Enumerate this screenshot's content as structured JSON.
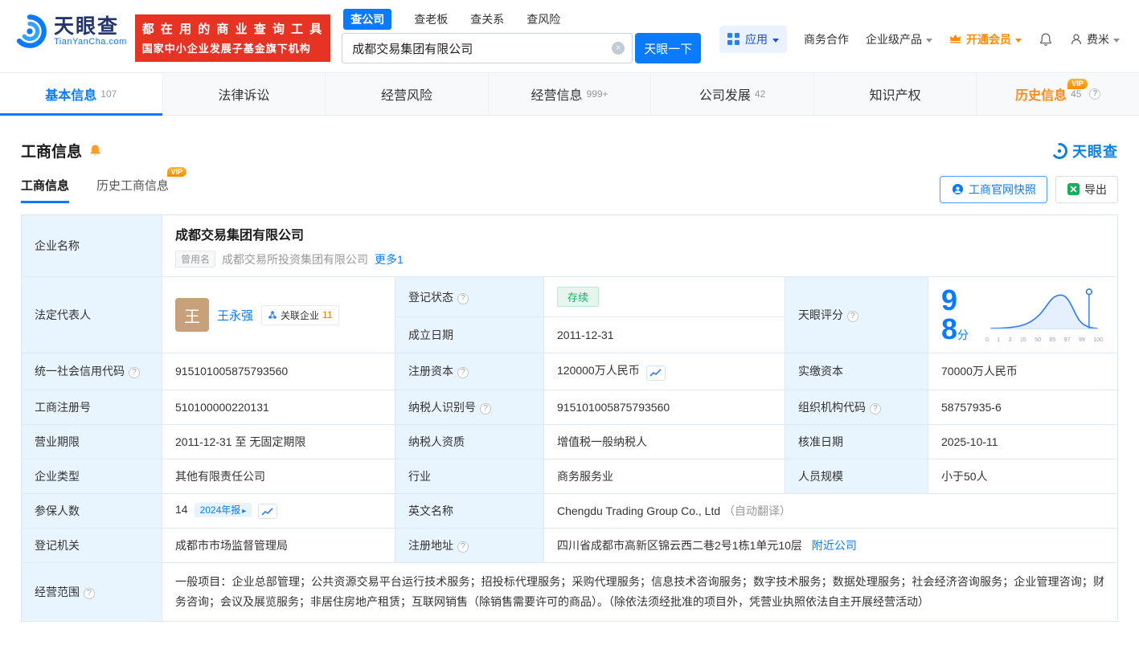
{
  "colors": {
    "brand_blue": "#0a7bff",
    "slogan_red": "#e73324",
    "vip_orange": "#ff8a00",
    "status_green": "#12b268",
    "label_cell_bg": "#e9f5fe"
  },
  "header": {
    "brand": {
      "name": "天眼查",
      "domain": "TianYanCha.com"
    },
    "slogan": [
      "都 在 用 的 商 业 查 询 工 具",
      "国家中小企业发展子基金旗下机构"
    ],
    "search_tabs": [
      "查公司",
      "查老板",
      "查关系",
      "查风险"
    ],
    "search": {
      "value": "成都交易集团有限公司",
      "button": "天眼一下"
    },
    "nav": {
      "apps": "应用",
      "cooperation": "商务合作",
      "enterprise": "企业级产品",
      "vip": "开通会员",
      "user": "费米"
    }
  },
  "vip_badge": "VIP",
  "tabs": [
    {
      "label": "基本信息",
      "count": "107"
    },
    {
      "label": "法律诉讼"
    },
    {
      "label": "经营风险"
    },
    {
      "label": "经营信息",
      "count": "999+"
    },
    {
      "label": "公司发展",
      "count": "42"
    },
    {
      "label": "知识产权"
    },
    {
      "label": "历史信息",
      "count": "45"
    }
  ],
  "section": {
    "title": "工商信息",
    "brand": "天眼查",
    "subtab_current": "工商信息",
    "subtab_history": "历史工商信息",
    "snapshot_button": "工商官网快照",
    "export_button": "导出"
  },
  "fields": {
    "company_name": {
      "label": "企业名称",
      "value": "成都交易集团有限公司"
    },
    "former_name": {
      "tag": "曾用名",
      "value": "成都交易所投资集团有限公司",
      "more": "更多1"
    },
    "legal_rep": {
      "label": "法定代表人",
      "avatar": "王",
      "name": "王永强",
      "related_label": "关联企业",
      "related_count": "11"
    },
    "reg_status": {
      "label": "登记状态",
      "value": "存续"
    },
    "establish_date": {
      "label": "成立日期",
      "value": "2011-12-31"
    },
    "tyc_score": {
      "label": "天眼评分",
      "score": "98",
      "unit": "分",
      "ticks": [
        "0",
        "1",
        "3",
        "15",
        "50",
        "85",
        "97",
        "99",
        "100"
      ]
    },
    "credit_code": {
      "label": "统一社会信用代码",
      "value": "915101005875793560"
    },
    "reg_capital": {
      "label": "注册资本",
      "value": "120000万人民币"
    },
    "paid_capital": {
      "label": "实缴资本",
      "value": "70000万人民币"
    },
    "reg_number": {
      "label": "工商注册号",
      "value": "510100000220131"
    },
    "taxpayer_id": {
      "label": "纳税人识别号",
      "value": "915101005875793560"
    },
    "org_code": {
      "label": "组织机构代码",
      "value": "58757935-6"
    },
    "business_term": {
      "label": "营业期限",
      "value": "2011-12-31 至 无固定期限"
    },
    "taxpayer_quality": {
      "label": "纳税人资质",
      "value": "增值税一般纳税人"
    },
    "approval_date": {
      "label": "核准日期",
      "value": "2025-10-11"
    },
    "company_type": {
      "label": "企业类型",
      "value": "其他有限责任公司"
    },
    "industry": {
      "label": "行业",
      "value": "商务服务业"
    },
    "staff_size": {
      "label": "人员规模",
      "value": "小于50人"
    },
    "insured_count": {
      "label": "参保人数",
      "value": "14",
      "report_tag": "2024年报"
    },
    "english_name": {
      "label": "英文名称",
      "value": "Chengdu Trading Group Co., Ltd",
      "note": "（自动翻译）"
    },
    "reg_authority": {
      "label": "登记机关",
      "value": "成都市市场监督管理局"
    },
    "reg_address": {
      "label": "注册地址",
      "value": "四川省成都市高新区锦云西二巷2号1栋1单元10层",
      "nearby": "附近公司"
    },
    "business_scope": {
      "label": "经营范围",
      "value": "一般项目：企业总部管理；公共资源交易平台运行技术服务；招投标代理服务；采购代理服务；信息技术咨询服务；数字技术服务；数据处理服务；社会经济咨询服务；企业管理咨询；财务咨询；会议及展览服务；非居住房地产租赁；互联网销售（除销售需要许可的商品）。（除依法须经批准的项目外，凭营业执照依法自主开展经营活动）"
    }
  }
}
